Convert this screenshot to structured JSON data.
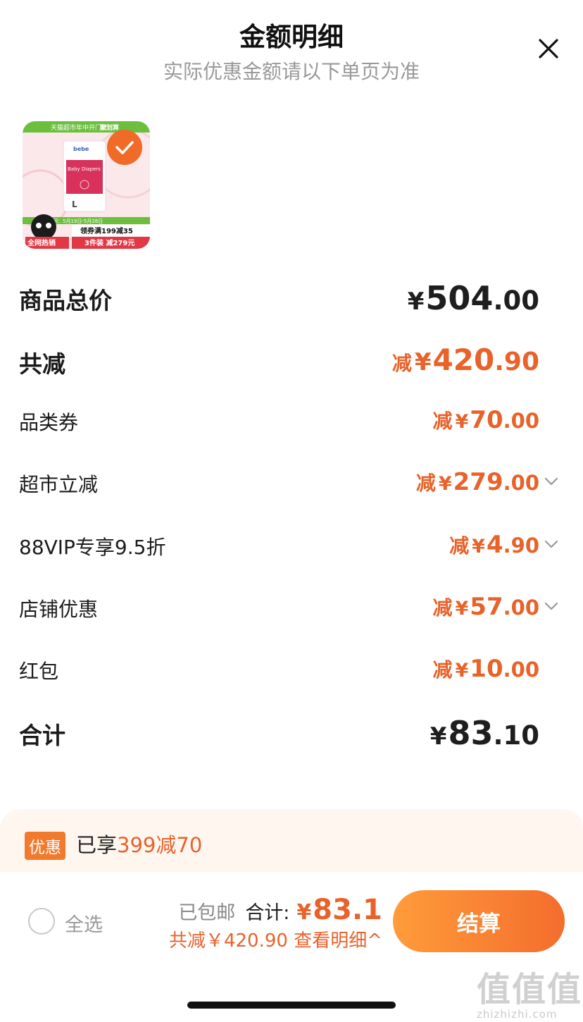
{
  "header": {
    "title": "金额明细",
    "subtitle": "实际优惠金额请以下单页为准"
  },
  "product": {
    "banner_top": "天猫超市年中开门红",
    "banner_tag": "聚划算",
    "brand": "bebe",
    "package_text": "Baby Diapers",
    "size": "L",
    "date_band": "活动时间：5月19日-5月28日",
    "coupon_text": "领券满199减35",
    "badge": "全网热销",
    "promo_text": "3件装 减279元",
    "selected": true
  },
  "rows": [
    {
      "label": "商品总价",
      "prefix": "",
      "yen": "¥",
      "int": "504",
      "dec": ".00",
      "style": "big",
      "color": "dark",
      "chevron": false
    },
    {
      "label": "共减",
      "prefix": "减",
      "yen": "¥",
      "int": "420",
      "dec": ".90",
      "style": "big",
      "color": "orange",
      "chevron": false
    },
    {
      "label": "品类券",
      "prefix": "减",
      "yen": "¥",
      "int": "70",
      "dec": ".00",
      "style": "small",
      "color": "orange",
      "chevron": false
    },
    {
      "label": "超市立减",
      "prefix": "减",
      "yen": "¥",
      "int": "279",
      "dec": ".00",
      "style": "small",
      "color": "orange",
      "chevron": true
    },
    {
      "label": "88VIP专享9.5折",
      "prefix": "减",
      "yen": "¥",
      "int": "4",
      "dec": ".90",
      "style": "small",
      "color": "orange",
      "chevron": true
    },
    {
      "label": "店铺优惠",
      "prefix": "减",
      "yen": "¥",
      "int": "57",
      "dec": ".00",
      "style": "small",
      "color": "orange",
      "chevron": true
    },
    {
      "label": "红包",
      "prefix": "减",
      "yen": "¥",
      "int": "10",
      "dec": ".00",
      "style": "small",
      "color": "orange",
      "chevron": false
    },
    {
      "label": "合计",
      "prefix": "",
      "yen": "¥",
      "int": "83",
      "dec": ".10",
      "style": "big",
      "color": "dark",
      "chevron": false
    }
  ],
  "promo": {
    "badge": "优惠",
    "text_prefix": "已享",
    "text_highlight": "399减70"
  },
  "footer": {
    "select_all": "全选",
    "shipping": "已包邮",
    "total_label": "合计:",
    "total_yen": "¥",
    "total_value": "83.1",
    "discount_line": "共减￥420.90  查看明细^",
    "checkout": "结算"
  },
  "watermark": {
    "logo": "值值值",
    "text": "zhizhizhi.com"
  },
  "colors": {
    "accent": "#e8622a",
    "checkout_gradient_start": "#ff9c3a",
    "checkout_gradient_end": "#f46d2d",
    "promo_bg": "#fff7ef"
  }
}
